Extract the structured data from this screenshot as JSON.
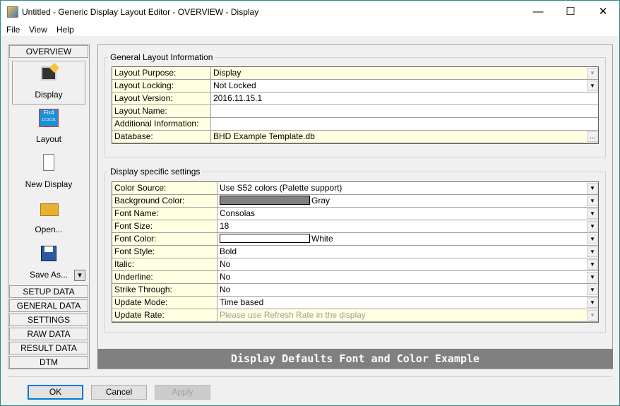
{
  "window": {
    "title": "Untitled - Generic Display Layout Editor -  OVERVIEW - Display",
    "minimize": "—",
    "maximize": "☐",
    "close": "✕"
  },
  "menu": [
    "File",
    "View",
    "Help"
  ],
  "nav": {
    "header": "OVERVIEW",
    "items": [
      {
        "label": "Display",
        "icon": "monitor-edit-icon"
      },
      {
        "label": "Layout",
        "icon": "fix4-layout-icon",
        "icon_text": "Fix4",
        "icon_time": "12:31:01"
      },
      {
        "label": "New Display",
        "icon": "new-document-icon"
      },
      {
        "label": "Open...",
        "icon": "folder-open-icon"
      },
      {
        "label": "Save As...",
        "icon": "floppy-disk-icon"
      }
    ],
    "save_dropdown": "▾",
    "sections": [
      "SETUP DATA",
      "GENERAL DATA",
      "SETTINGS",
      "RAW DATA",
      "RESULT DATA",
      "DTM"
    ]
  },
  "general": {
    "title": "General Layout Information",
    "rows": [
      {
        "label": "Layout Purpose:",
        "value": "Display",
        "control": "dropdown-disabled"
      },
      {
        "label": "Layout Locking:",
        "value": "Not Locked",
        "control": "dropdown"
      },
      {
        "label": "Layout Version:",
        "value": "2016.11.15.1"
      },
      {
        "label": "Layout Name:",
        "value": ""
      },
      {
        "label": "Additional Information:",
        "value": ""
      },
      {
        "label": "Database:",
        "value": "BHD Example Template.db",
        "control": "browse",
        "browse_label": "..."
      }
    ]
  },
  "display": {
    "title": "Display specific settings",
    "rows": [
      {
        "label": "Color Source:",
        "value": "Use S52 colors (Palette support)",
        "control": "dropdown"
      },
      {
        "label": "Background Color:",
        "value": "Gray",
        "swatch": "#808080",
        "control": "dropdown"
      },
      {
        "label": "Font Name:",
        "value": "Consolas",
        "control": "dropdown"
      },
      {
        "label": "Font Size:",
        "value": "18",
        "control": "dropdown"
      },
      {
        "label": "Font Color:",
        "value": "White",
        "swatch": "#ffffff",
        "control": "dropdown"
      },
      {
        "label": "Font Style:",
        "value": "Bold",
        "control": "dropdown"
      },
      {
        "label": "Italic:",
        "value": "No",
        "control": "dropdown"
      },
      {
        "label": "Underline:",
        "value": "No",
        "control": "dropdown"
      },
      {
        "label": "Strike Through:",
        "value": "No",
        "control": "dropdown"
      },
      {
        "label": "Update Mode:",
        "value": "Time based",
        "control": "dropdown"
      },
      {
        "label": "Update Rate:",
        "value": "Please use Refresh Rate in the display",
        "control": "dropdown-disabled"
      }
    ]
  },
  "banner": "Display Defaults Font and Color Example",
  "buttons": {
    "ok": "OK",
    "cancel": "Cancel",
    "apply": "Apply"
  }
}
